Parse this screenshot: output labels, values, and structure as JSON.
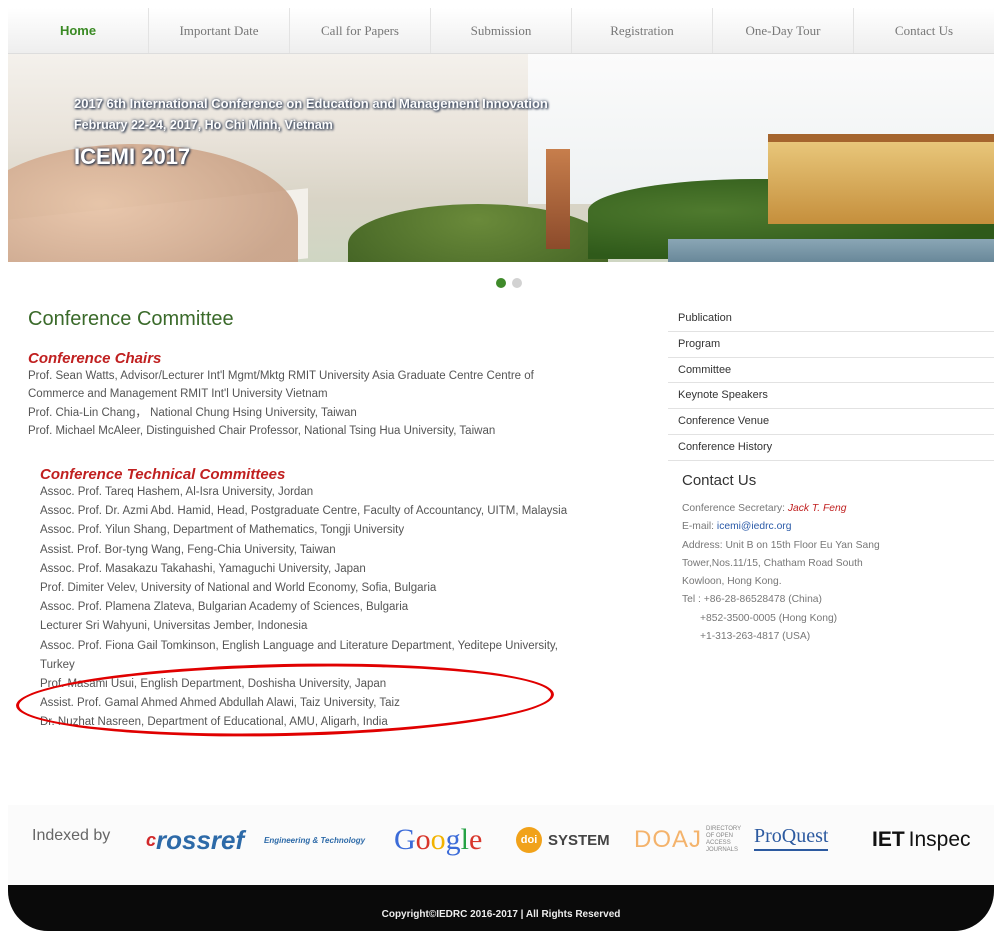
{
  "nav": {
    "items": [
      {
        "label": "Home",
        "active": true
      },
      {
        "label": "Important Date"
      },
      {
        "label": "Call for Papers"
      },
      {
        "label": "Submission"
      },
      {
        "label": "Registration"
      },
      {
        "label": "One-Day Tour"
      },
      {
        "label": "Contact Us"
      }
    ]
  },
  "banner": {
    "title": "2017 6th International Conference on Education and Management Innovation",
    "date_location": "February 22-24, 2017, Ho Chi Minh, Vietnam",
    "acronym": "ICEMI 2017"
  },
  "page": {
    "title": "Conference Committee"
  },
  "chairs": {
    "heading": "Conference Chairs",
    "lines": [
      "Prof. Sean Watts, Advisor/Lecturer Int'l Mgmt/Mktg RMIT University Asia Graduate Centre Centre of",
      "Commerce and Management RMIT Int'l University Vietnam",
      "Prof. Chia-Lin Chang， National Chung Hsing University, Taiwan",
      "Prof. Michael McAleer, Distinguished Chair Professor, National Tsing Hua University, Taiwan"
    ]
  },
  "technical": {
    "heading": "Conference Technical Committees",
    "lines": [
      "Assoc. Prof. Tareq Hashem, Al-Isra University, Jordan",
      "Assoc. Prof. Dr. Azmi Abd. Hamid, Head, Postgraduate Centre, Faculty of Accountancy, UITM, Malaysia",
      "Assoc. Prof. Yilun Shang, Department of Mathematics, Tongji University",
      "Assist. Prof. Bor-tyng Wang, Feng-Chia University, Taiwan",
      "Assoc. Prof. Masakazu Takahashi, Yamaguchi University, Japan",
      "Prof. Dimiter Velev, University of National and World Economy, Sofia, Bulgaria",
      "Assoc. Prof. Plamena Zlateva, Bulgarian Academy of Sciences, Bulgaria",
      "Lecturer Sri Wahyuni, Universitas Jember, Indonesia",
      "Assoc. Prof. Fiona Gail Tomkinson, English Language and Literature Department, Yeditepe University,",
      "Turkey",
      "Prof. Masami Usui, English Department, Doshisha University, Japan",
      "Assist. Prof. Gamal Ahmed Ahmed Abdullah Alawi, Taiz University, Taiz",
      "Dr. Nuzhat Nasreen, Department of Educational, AMU, Aligarh, India"
    ]
  },
  "sidebar": {
    "items": [
      {
        "label": "Publication"
      },
      {
        "label": "Program"
      },
      {
        "label": "Committee"
      },
      {
        "label": "Keynote Speakers"
      },
      {
        "label": "Conference Venue"
      },
      {
        "label": "Conference History"
      }
    ]
  },
  "contact": {
    "heading": "Contact Us",
    "secretary_label": "Conference Secretary: ",
    "secretary_name": "Jack T. Feng",
    "email_label": "E-mail: ",
    "email": "icemi@iedrc.org",
    "address_lines": [
      "Address: Unit B on 15th Floor Eu Yan Sang",
      "Tower,Nos.11/15, Chatham Road South",
      "Kowloon, Hong Kong."
    ],
    "tel_lines": [
      "Tel : +86-28-86528478 (China)",
      "+852-3500-0005 (Hong Kong)",
      "+1-313-263-4817 (USA)"
    ]
  },
  "indexed": {
    "label": "Indexed by",
    "logos": {
      "crossref_c": "c",
      "crossref": "rossref",
      "engineering": "Engineering & Technology",
      "google": [
        "G",
        "o",
        "o",
        "g",
        "l",
        "e"
      ],
      "doi_badge": "doi",
      "doi": "SYSTEM",
      "doaj": "DOAJ",
      "doaj_small": "DIRECTORY OF OPEN ACCESS JOURNALS",
      "proquest": "ProQuest",
      "iet_bold": "IET",
      "iet": "Inspec"
    }
  },
  "footer": {
    "copyright": "Copyright©IEDRC 2016-2017 | All Rights Reserved"
  },
  "colors": {
    "accent_green": "#3f8a2a",
    "heading_red": "#c02020",
    "circle_red": "#e00000",
    "link_blue": "#2a5aa8"
  },
  "carousel": {
    "slides": 2,
    "active_slide": 1
  }
}
